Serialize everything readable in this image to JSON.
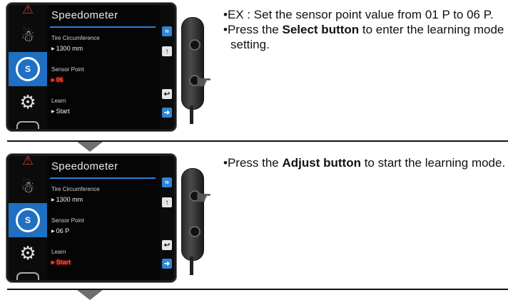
{
  "steps": [
    {
      "screen": {
        "title": "Speedometer",
        "tire_label": "Tire Circumference",
        "tire_value": "1300 mm",
        "sensor_label": "Sensor Point",
        "sensor_value": "06",
        "learn_label": "Learn",
        "learn_value": "Start"
      },
      "text": {
        "line1_prefix": "EX : Set the sensor point value from 01 P to 06 P.",
        "line2_before": "Press the ",
        "line2_bold": "Select button",
        "line2_after": " to enter the learning mode setting."
      }
    },
    {
      "screen": {
        "title": "Speedometer",
        "tire_label": "Tire Circumference",
        "tire_value": "1300 mm",
        "sensor_label": "Sensor Point",
        "sensor_value": "06 P",
        "learn_label": "Learn",
        "learn_value": "Start"
      },
      "text": {
        "line1_before": "Press the ",
        "line1_bold": "Adjust button",
        "line1_after": " to start the learning mode."
      }
    }
  ],
  "icons": {
    "left_menu": [
      "warning-icon",
      "lamp-icon",
      "speedometer-icon",
      "gear-icon",
      "gauge-icon"
    ],
    "right_menu": [
      "graph-icon",
      "up-icon",
      "back-icon",
      "next-icon"
    ]
  },
  "colors": {
    "accent": "#1f6fc2",
    "blink": "#ff4a3a"
  }
}
